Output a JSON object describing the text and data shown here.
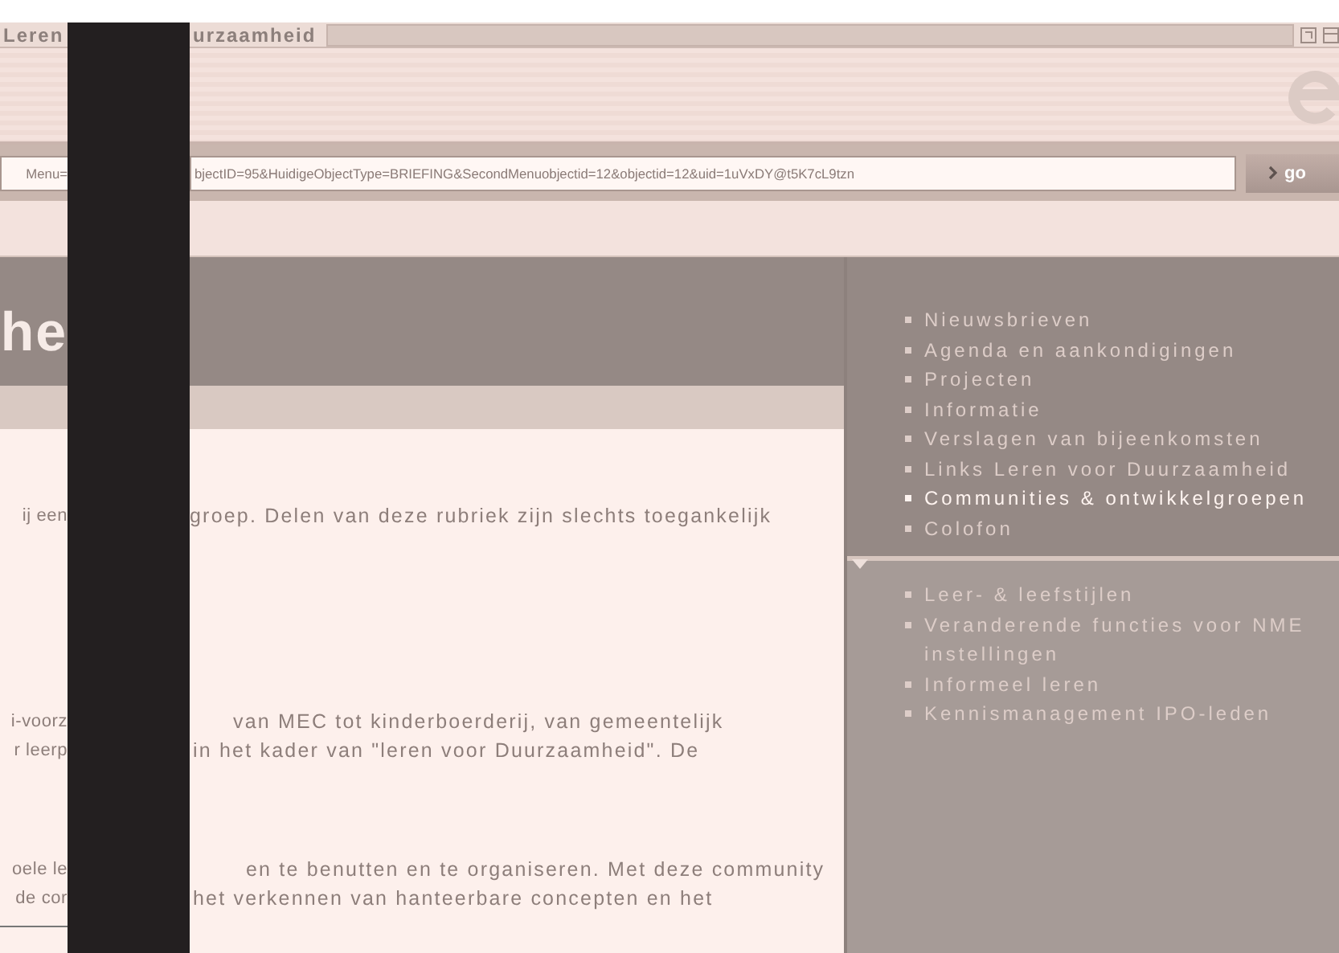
{
  "window": {
    "title_left": "Leren",
    "title_right": "urzaamheid"
  },
  "address_bar": {
    "url_left": "Menu=",
    "url_right": "bjectID=95&HuidigeObjectType=BRIEFING&SecondMenuobjectid=12&objectid=12&uid=1uVxDY@t5K7cL9tzn",
    "go_label": "go"
  },
  "header": {
    "title_fragment": "he"
  },
  "content": {
    "paragraphs": [
      {
        "lines": [
          {
            "left": "ij een",
            "right": "groep. Delen van deze rubriek zijn slechts toegankelijk"
          }
        ]
      },
      {
        "lines": [
          {
            "left": "i-voorz",
            "right": "van MEC tot kinderboerderij, van gemeentelijk"
          },
          {
            "left": "r leerp",
            "right": "in het kader van \"leren voor Duurzaamheid\". De"
          }
        ]
      },
      {
        "lines": [
          {
            "left": "oele le",
            "right": "en te benutten en te organiseren. Met deze community"
          },
          {
            "left": "de cor",
            "right": "het verkennen van hanteerbare concepten en het"
          }
        ]
      }
    ]
  },
  "sidebar": {
    "menu": [
      {
        "label": "Nieuwsbrieven",
        "selected": false
      },
      {
        "label": "Agenda en aankondigingen",
        "selected": false
      },
      {
        "label": "Projecten",
        "selected": false
      },
      {
        "label": "Informatie",
        "selected": false
      },
      {
        "label": "Verslagen van bijeenkomsten",
        "selected": false
      },
      {
        "label": "Links Leren voor Duurzaamheid",
        "selected": false
      },
      {
        "label": "Communities & ontwikkelgroepen",
        "selected": true
      },
      {
        "label": "Colofon",
        "selected": false
      }
    ],
    "submenu": [
      {
        "label": "Leer- & leefstijlen",
        "selected": false
      },
      {
        "label": "Veranderende functies voor NME instellingen",
        "selected": false
      },
      {
        "label": "Informeel leren",
        "selected": false
      },
      {
        "label": "Kennismanagement IPO-leden",
        "selected": false
      }
    ]
  }
}
